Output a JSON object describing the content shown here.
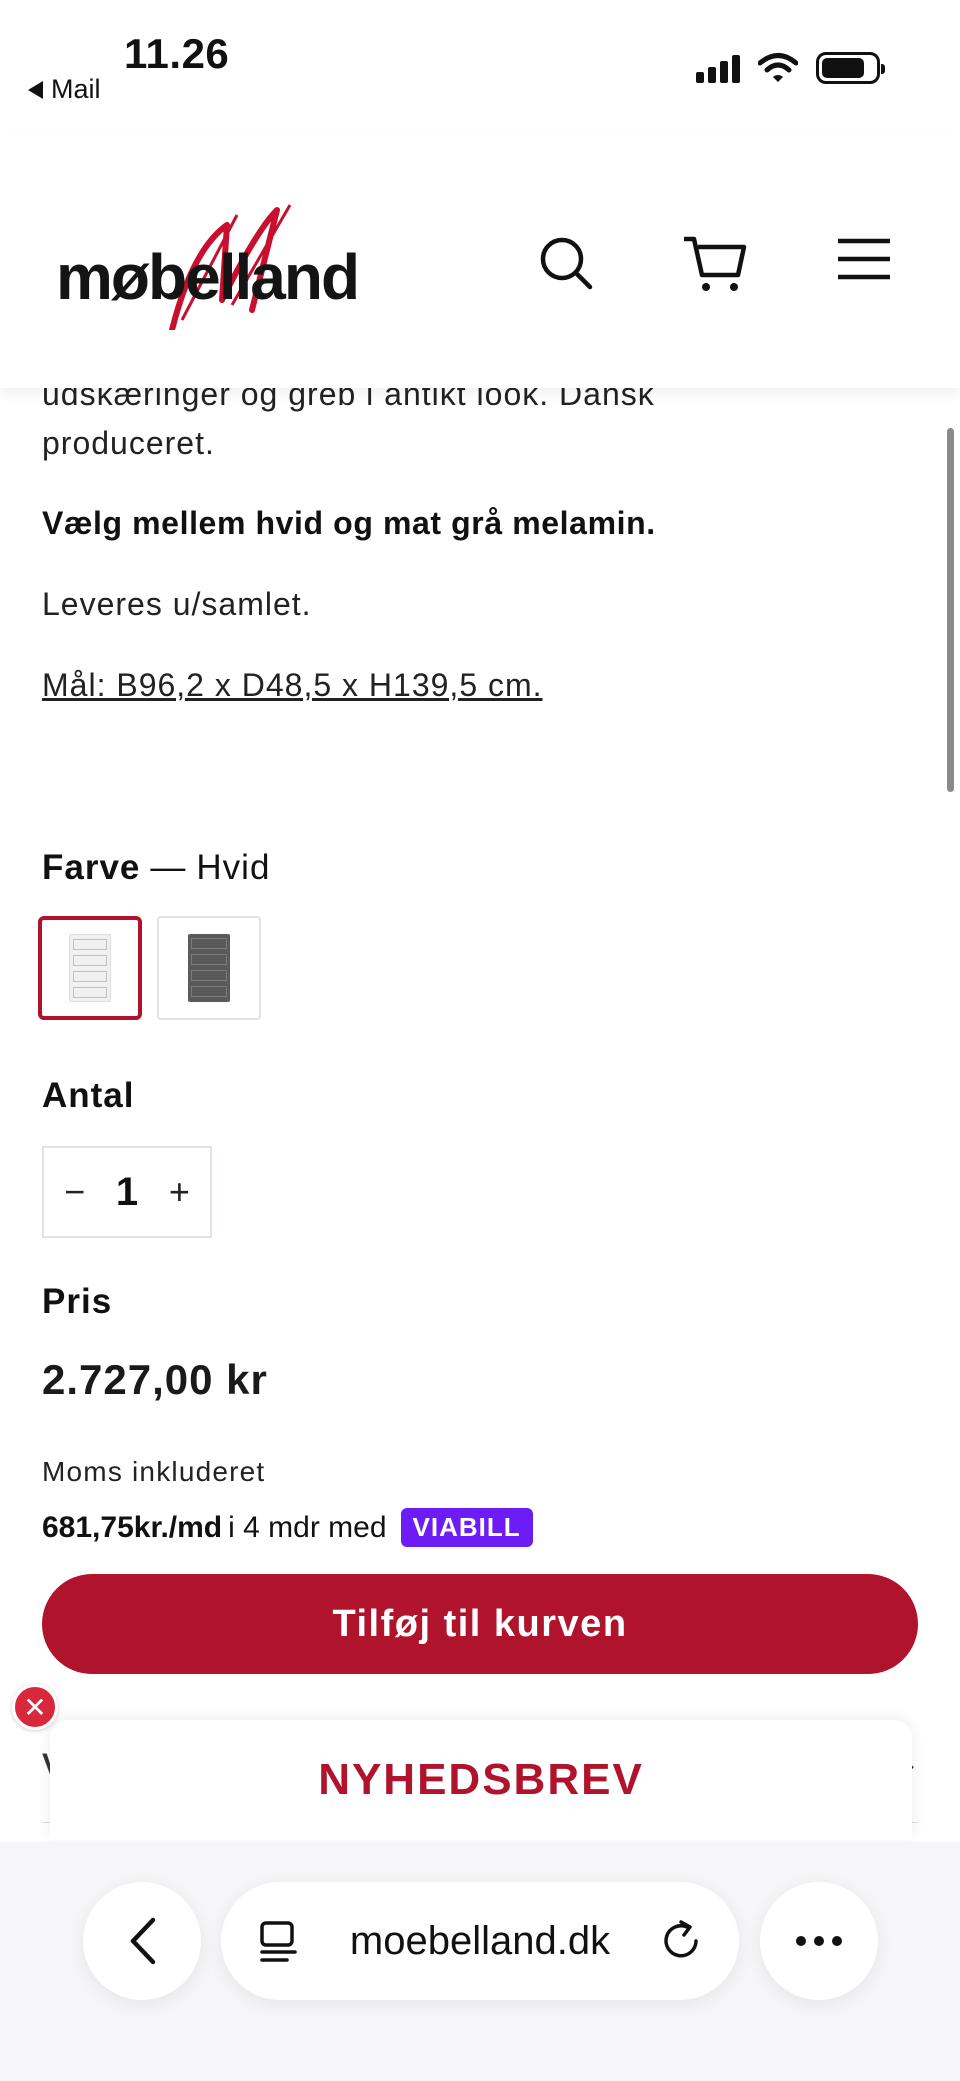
{
  "status_bar": {
    "time": "11.26",
    "back_app": "Mail",
    "icons": [
      "signal-icon",
      "wifi-icon",
      "battery-icon"
    ]
  },
  "header": {
    "logo_text": "møbelland",
    "icons": [
      "search-icon",
      "cart-icon",
      "menu-icon"
    ],
    "brand_color": "#b0142c"
  },
  "description": {
    "line1": "udskæringer og greb i antikt look. Dansk",
    "line2": "produceret.",
    "bold": "Vælg mellem hvid og mat grå melamin.",
    "assembly": "Leveres u/samlet.",
    "dimensions": "Mål: B96,2 x D48,5 x H139,5 cm."
  },
  "color": {
    "label": "Farve",
    "separator": "—",
    "selected_value": "Hvid",
    "options": [
      {
        "name": "Hvid",
        "swatch": "#f3f3f3",
        "selected": true
      },
      {
        "name": "Grå",
        "swatch": "#5a5a5a",
        "selected": false
      }
    ]
  },
  "quantity": {
    "label": "Antal",
    "minus": "−",
    "value": "1",
    "plus": "+"
  },
  "price": {
    "label": "Pris",
    "amount": "2.727,00 kr",
    "vat_note": "Moms inkluderet",
    "finance_amount": "681,75kr./md",
    "finance_rest": "i 4 mdr med",
    "finance_brand": "VIABILL",
    "finance_brand_color": "#6c1cf5"
  },
  "cart_button": {
    "label": "Tilføj til kurven",
    "color": "#b0142c"
  },
  "newsletter": {
    "title": "NYHEDSBREV",
    "underlay_letter": "V"
  },
  "browser": {
    "url": "moebelland.dk",
    "icons": [
      "back-chevron-icon",
      "page-icon",
      "reload-icon",
      "more-icon"
    ]
  }
}
